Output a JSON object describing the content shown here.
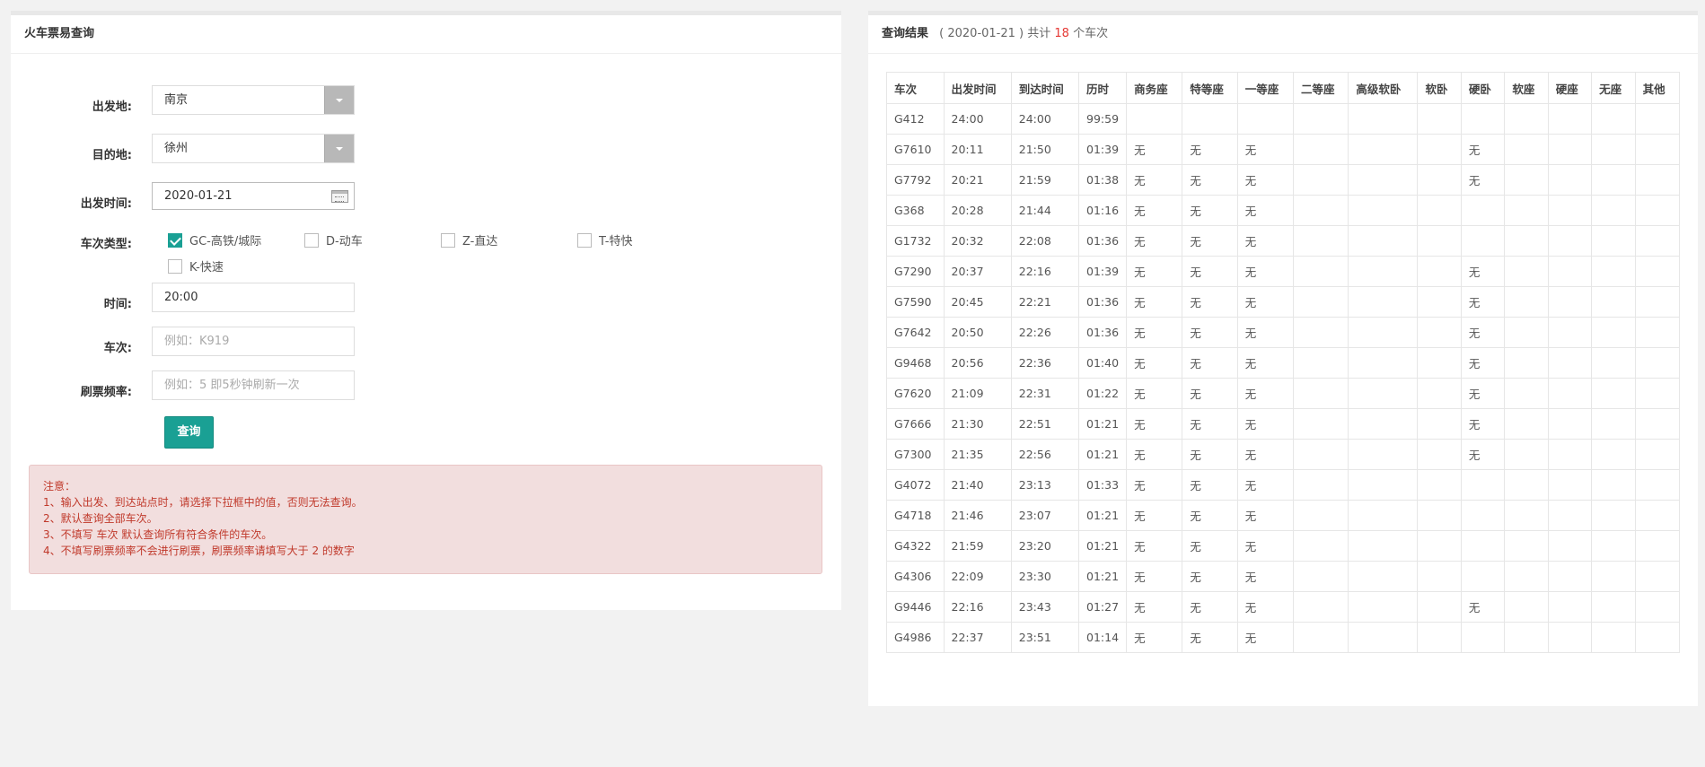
{
  "left": {
    "title": "火车票易查询",
    "form": {
      "from_label": "出发地:",
      "from_value": "南京",
      "to_label": "目的地:",
      "to_value": "徐州",
      "date_label": "出发时间:",
      "date_value": "2020-01-21",
      "type_label": "车次类型:",
      "types": [
        {
          "label": "GC-高铁/城际",
          "checked": true
        },
        {
          "label": "D-动车",
          "checked": false
        },
        {
          "label": "Z-直达",
          "checked": false
        },
        {
          "label": "T-特快",
          "checked": false
        },
        {
          "label": "K-快速",
          "checked": false
        }
      ],
      "time_label": "时间:",
      "time_value": "20:00",
      "train_label": "车次:",
      "train_placeholder": "例如：K919",
      "freq_label": "刷票频率:",
      "freq_placeholder": "例如：5 即5秒钟刷新一次",
      "query_button": "查询"
    },
    "notice": [
      "注意：",
      "1、输入出发、到达站点时，请选择下拉框中的值，否则无法查询。",
      "2、默认查询全部车次。",
      "3、不填写 车次 默认查询所有符合条件的车次。",
      "4、不填写刷票频率不会进行刷票，刷票频率请填写大于 2 的数字"
    ]
  },
  "right": {
    "title": "查询结果",
    "date_prefix": "( 2020-01-21 ) 共计",
    "count": "18",
    "count_suffix": "个车次",
    "columns": [
      "车次",
      "出发时间",
      "到达时间",
      "历时",
      "商务座",
      "特等座",
      "一等座",
      "二等座",
      "高级软卧",
      "软卧",
      "硬卧",
      "软座",
      "硬座",
      "无座",
      "其他"
    ],
    "rows": [
      [
        "G412",
        "24:00",
        "24:00",
        "99:59",
        "",
        "",
        "",
        "",
        "",
        "",
        "",
        "",
        "",
        "",
        ""
      ],
      [
        "G7610",
        "20:11",
        "21:50",
        "01:39",
        "无",
        "无",
        "无",
        "",
        "",
        "",
        "无",
        "",
        "",
        "",
        ""
      ],
      [
        "G7792",
        "20:21",
        "21:59",
        "01:38",
        "无",
        "无",
        "无",
        "",
        "",
        "",
        "无",
        "",
        "",
        "",
        ""
      ],
      [
        "G368",
        "20:28",
        "21:44",
        "01:16",
        "无",
        "无",
        "无",
        "",
        "",
        "",
        "",
        "",
        "",
        "",
        ""
      ],
      [
        "G1732",
        "20:32",
        "22:08",
        "01:36",
        "无",
        "无",
        "无",
        "",
        "",
        "",
        "",
        "",
        "",
        "",
        ""
      ],
      [
        "G7290",
        "20:37",
        "22:16",
        "01:39",
        "无",
        "无",
        "无",
        "",
        "",
        "",
        "无",
        "",
        "",
        "",
        ""
      ],
      [
        "G7590",
        "20:45",
        "22:21",
        "01:36",
        "无",
        "无",
        "无",
        "",
        "",
        "",
        "无",
        "",
        "",
        "",
        ""
      ],
      [
        "G7642",
        "20:50",
        "22:26",
        "01:36",
        "无",
        "无",
        "无",
        "",
        "",
        "",
        "无",
        "",
        "",
        "",
        ""
      ],
      [
        "G9468",
        "20:56",
        "22:36",
        "01:40",
        "无",
        "无",
        "无",
        "",
        "",
        "",
        "无",
        "",
        "",
        "",
        ""
      ],
      [
        "G7620",
        "21:09",
        "22:31",
        "01:22",
        "无",
        "无",
        "无",
        "",
        "",
        "",
        "无",
        "",
        "",
        "",
        ""
      ],
      [
        "G7666",
        "21:30",
        "22:51",
        "01:21",
        "无",
        "无",
        "无",
        "",
        "",
        "",
        "无",
        "",
        "",
        "",
        ""
      ],
      [
        "G7300",
        "21:35",
        "22:56",
        "01:21",
        "无",
        "无",
        "无",
        "",
        "",
        "",
        "无",
        "",
        "",
        "",
        ""
      ],
      [
        "G4072",
        "21:40",
        "23:13",
        "01:33",
        "无",
        "无",
        "无",
        "",
        "",
        "",
        "",
        "",
        "",
        "",
        ""
      ],
      [
        "G4718",
        "21:46",
        "23:07",
        "01:21",
        "无",
        "无",
        "无",
        "",
        "",
        "",
        "",
        "",
        "",
        "",
        ""
      ],
      [
        "G4322",
        "21:59",
        "23:20",
        "01:21",
        "无",
        "无",
        "无",
        "",
        "",
        "",
        "",
        "",
        "",
        "",
        ""
      ],
      [
        "G4306",
        "22:09",
        "23:30",
        "01:21",
        "无",
        "无",
        "无",
        "",
        "",
        "",
        "",
        "",
        "",
        "",
        ""
      ],
      [
        "G9446",
        "22:16",
        "23:43",
        "01:27",
        "无",
        "无",
        "无",
        "",
        "",
        "",
        "无",
        "",
        "",
        "",
        ""
      ],
      [
        "G4986",
        "22:37",
        "23:51",
        "01:14",
        "无",
        "无",
        "无",
        "",
        "",
        "",
        "",
        "",
        "",
        "",
        ""
      ]
    ]
  }
}
